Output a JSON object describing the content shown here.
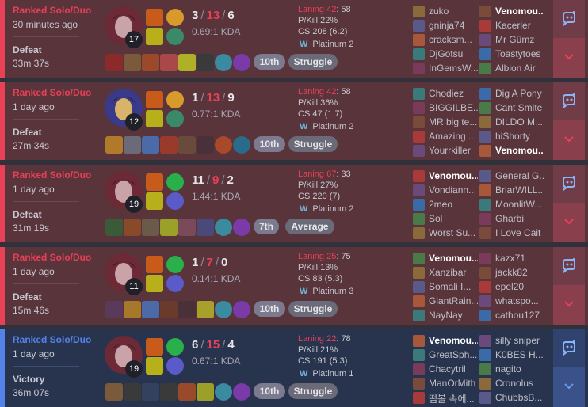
{
  "colors": {
    "loss": "#e84057",
    "win": "#5383e8",
    "loss_bg": "#59343b",
    "win_bg": "#28344e"
  },
  "matches": [
    {
      "queue": "Ranked Solo/Duo",
      "time_ago": "30 minutes ago",
      "result": "Defeat",
      "duration": "33m 37s",
      "level": "17",
      "kda": {
        "k": "3",
        "d": "13",
        "a": "6"
      },
      "kda_ratio": "0.69:1 KDA",
      "position": "10th",
      "badge": "Struggle",
      "laning_label": "Laning 42",
      "laning_score": ": 58",
      "pkill": "P/Kill 22%",
      "cs": "CS 208 (6.2)",
      "tier": "Platinum 2",
      "team1": [
        "zuko",
        "gninja74",
        "cracksm...",
        "DjGotsu",
        "InGemsW..."
      ],
      "team2": [
        "Venomou...",
        "Kacerler",
        "Mr Gümz",
        "Toastytoes",
        "Albion Air"
      ],
      "me_team": 2,
      "me_index": 0
    },
    {
      "queue": "Ranked Solo/Duo",
      "time_ago": "1 day ago",
      "result": "Defeat",
      "duration": "27m 34s",
      "level": "12",
      "kda": {
        "k": "1",
        "d": "13",
        "a": "9"
      },
      "kda_ratio": "0.77:1 KDA",
      "position": "10th",
      "badge": "Struggle",
      "laning_label": "Laning 42",
      "laning_score": ": 58",
      "pkill": "P/Kill 36%",
      "cs": "CS 47 (1.7)",
      "tier": "Platinum 2",
      "team1": [
        "Chodiez",
        "BIGGILBE...",
        "MR big te...",
        "Amazing ...",
        "Yourrkiller"
      ],
      "team2": [
        "Dig A Pony",
        "Cant Smite",
        "DILDO M...",
        "hiShorty",
        "Venomou..."
      ],
      "me_team": 2,
      "me_index": 4
    },
    {
      "queue": "Ranked Solo/Duo",
      "time_ago": "1 day ago",
      "result": "Defeat",
      "duration": "31m 19s",
      "level": "19",
      "kda": {
        "k": "11",
        "d": "9",
        "a": "2"
      },
      "kda_ratio": "1.44:1 KDA",
      "position": "7th",
      "badge": "Average",
      "laning_label": "Laning 67",
      "laning_score": ": 33",
      "pkill": "P/Kill 27%",
      "cs": "CS 220 (7)",
      "tier": "Platinum 2",
      "team1": [
        "Venomou...",
        "Vondiann...",
        "2meo",
        "Sol",
        "Worst Su..."
      ],
      "team2": [
        "General G...",
        "BriarWILL...",
        "MoonlitW...",
        "Gharbi",
        "I Love Cait"
      ],
      "me_team": 1,
      "me_index": 0
    },
    {
      "queue": "Ranked Solo/Duo",
      "time_ago": "1 day ago",
      "result": "Defeat",
      "duration": "15m 46s",
      "level": "11",
      "kda": {
        "k": "1",
        "d": "7",
        "a": "0"
      },
      "kda_ratio": "0.14:1 KDA",
      "position": "10th",
      "badge": "Struggle",
      "laning_label": "Laning 25",
      "laning_score": ": 75",
      "pkill": "P/Kill 13%",
      "cs": "CS 83 (5.3)",
      "tier": "Platinum 3",
      "team1": [
        "Venomou...",
        "Xanzibar",
        "Somali I...",
        "GiantRain...",
        "NayNay"
      ],
      "team2": [
        "kazx71",
        "jackk82",
        "epel20",
        "whatspo...",
        "cathou127"
      ],
      "me_team": 1,
      "me_index": 0
    },
    {
      "queue": "Ranked Solo/Duo",
      "time_ago": "1 day ago",
      "result": "Victory",
      "duration": "36m 07s",
      "level": "19",
      "kda": {
        "k": "6",
        "d": "15",
        "a": "4"
      },
      "kda_ratio": "0.67:1 KDA",
      "position": "10th",
      "badge": "Struggle",
      "laning_label": "Laning 22",
      "laning_score": ": 78",
      "pkill": "P/Kill 21%",
      "cs": "CS 191 (5.3)",
      "tier": "Platinum 1",
      "team1": [
        "Venomou...",
        "GreatSph...",
        "Chacytril",
        "ManOrMith",
        "떰볼 속에..."
      ],
      "team2": [
        "silly sniper",
        "K0BES H...",
        "nagito",
        "Cronolus",
        "ChubbsB..."
      ],
      "me_team": 1,
      "me_index": 0
    }
  ]
}
